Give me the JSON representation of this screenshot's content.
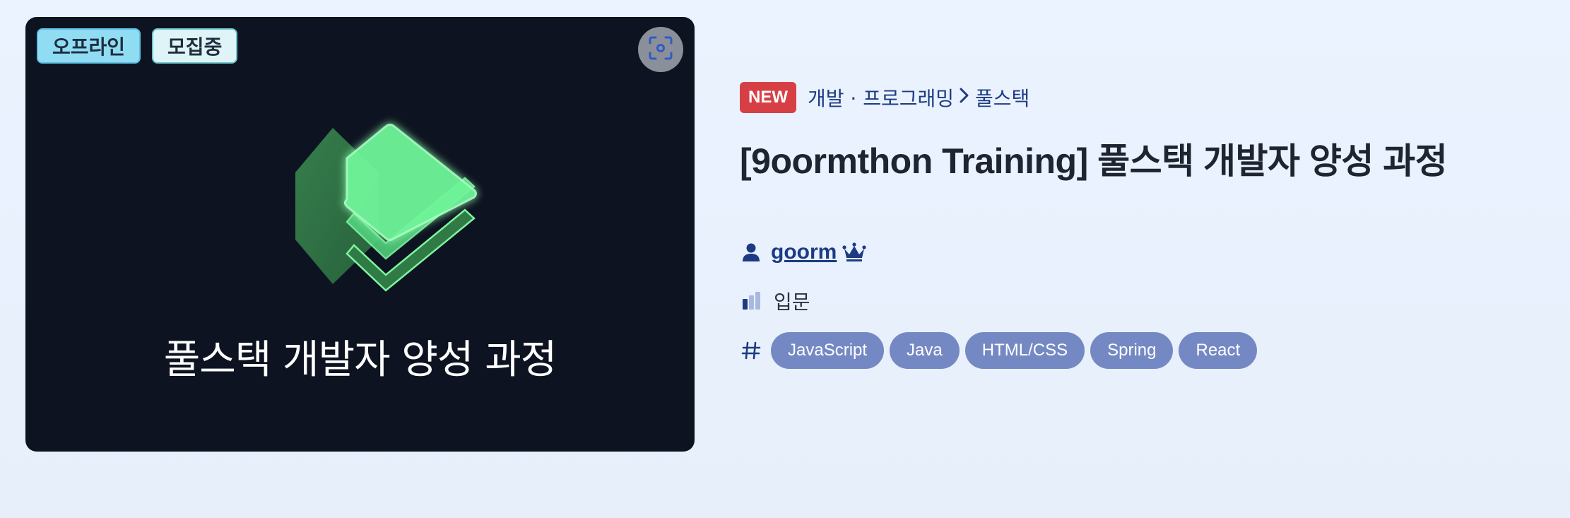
{
  "thumbnail": {
    "badges": [
      "오프라인",
      "모집중"
    ],
    "title": "풀스택 개발자 양성 과정",
    "capture_icon": "screenshot-icon",
    "logo_icon": "layered-cube-icon"
  },
  "course": {
    "new_label": "NEW",
    "breadcrumb": {
      "category": "개발 · 프로그래밍",
      "separator_icon": "chevron-right-icon",
      "subcategory": "풀스택"
    },
    "title": "[9oormthon Training] 풀스택 개발자 양성 과정",
    "author": {
      "name": "goorm",
      "icon": "user-icon",
      "badge_icon": "crown-icon"
    },
    "level": {
      "label": "입문",
      "icon": "level-bars-icon"
    },
    "tags_icon": "hash-icon",
    "tags": [
      "JavaScript",
      "Java",
      "HTML/CSS",
      "Spring",
      "React"
    ]
  },
  "colors": {
    "accent": "#1d3b83",
    "new_badge": "#d64045",
    "tag_bg": "#7489c4",
    "thumbnail_bg": "#0d1320"
  }
}
